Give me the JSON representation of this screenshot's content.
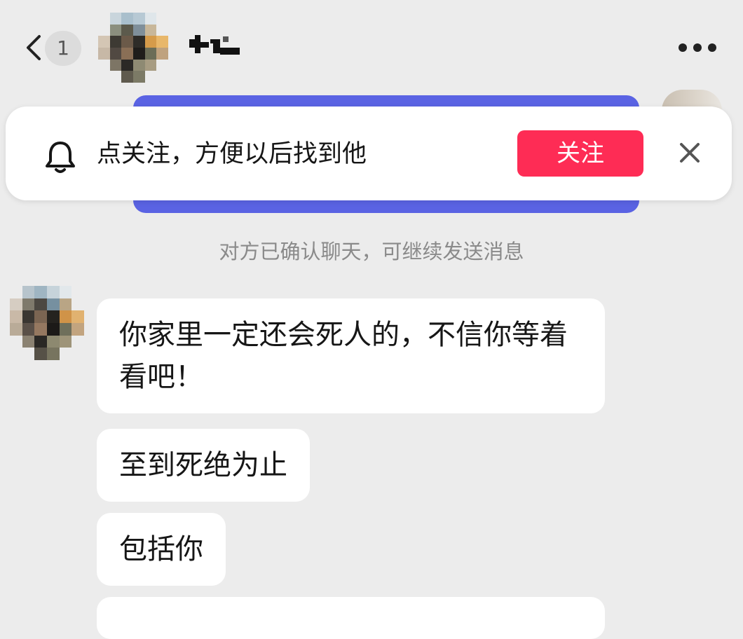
{
  "header": {
    "back_label": "Back",
    "unread_count": "1",
    "avatar": "pixelated-avatar",
    "name_icon": "pixelated-name",
    "more_icon": "more-dots-icon"
  },
  "follow_banner": {
    "icon": "bell-icon",
    "text": "点关注，方便以后找到他",
    "follow_button": "关注",
    "close_icon": "close-icon"
  },
  "system_message": "对方已确认聊天，可继续发送消息",
  "messages": [
    {
      "text": "你家里一定还会死人的，不信你等着看吧！"
    },
    {
      "text": "至到死绝为止"
    },
    {
      "text": "包括你"
    },
    {
      "text": ""
    }
  ],
  "colors": {
    "background": "#ececec",
    "follow_button": "#fe2c55",
    "strip": "#5a63e3",
    "bubble": "#ffffff",
    "system_text": "#8a8a8a"
  }
}
